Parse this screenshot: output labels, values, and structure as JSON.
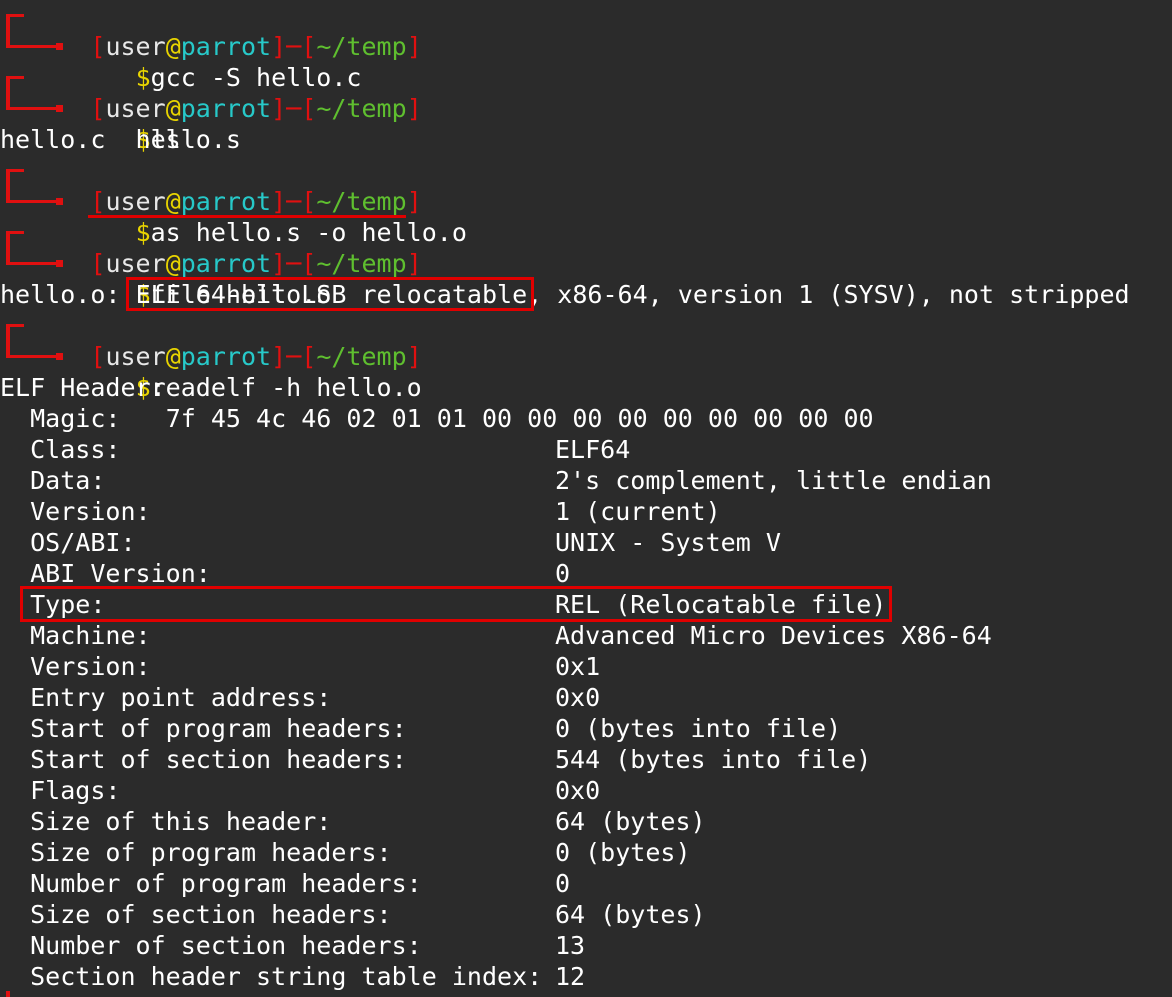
{
  "prompt": {
    "user": "user",
    "at": "@",
    "host": "parrot",
    "path": "~/temp",
    "dollar": "$"
  },
  "commands": [
    {
      "cmd": "gcc -S hello.c",
      "output": []
    },
    {
      "cmd": "ls",
      "output": [
        "hello.c  hello.s"
      ]
    },
    {
      "cmd": "as hello.s -o hello.o",
      "output": []
    },
    {
      "cmd": "file hello.o",
      "output": []
    },
    {
      "cmd": "readelf -h hello.o",
      "output": []
    }
  ],
  "file_output": {
    "prefix": "hello.o: ",
    "highlight": "ELF 64-bit LSB relocatable",
    "suffix": ", x86-64, version 1 (SYSV), not stripped"
  },
  "elf_header": {
    "title": "ELF Header:",
    "magic_label": "  Magic:   ",
    "magic_value": "7f 45 4c 46 02 01 01 00 00 00 00 00 00 00 00 00",
    "rows": [
      {
        "label": "  Class:",
        "value": "ELF64"
      },
      {
        "label": "  Data:",
        "value": "2's complement, little endian"
      },
      {
        "label": "  Version:",
        "value": "1 (current)"
      },
      {
        "label": "  OS/ABI:",
        "value": "UNIX - System V"
      },
      {
        "label": "  ABI Version:",
        "value": "0"
      },
      {
        "label": "  Type:",
        "value": "REL (Relocatable file)"
      },
      {
        "label": "  Machine:",
        "value": "Advanced Micro Devices X86-64"
      },
      {
        "label": "  Version:",
        "value": "0x1"
      },
      {
        "label": "  Entry point address:",
        "value": "0x0"
      },
      {
        "label": "  Start of program headers:",
        "value": "0 (bytes into file)"
      },
      {
        "label": "  Start of section headers:",
        "value": "544 (bytes into file)"
      },
      {
        "label": "  Flags:",
        "value": "0x0"
      },
      {
        "label": "  Size of this header:",
        "value": "64 (bytes)"
      },
      {
        "label": "  Size of program headers:",
        "value": "0 (bytes)"
      },
      {
        "label": "  Number of program headers:",
        "value": "0"
      },
      {
        "label": "  Size of section headers:",
        "value": "64 (bytes)"
      },
      {
        "label": "  Number of section headers:",
        "value": "13"
      },
      {
        "label": "  Section header string table index:",
        "value": "12"
      }
    ]
  },
  "colors": {
    "background": "#2b2b2b",
    "prompt_frame": "#e01010",
    "highlight": "#e00000",
    "host": "#27c9c9",
    "path": "#5fbf2f",
    "dollar": "#e8d400"
  }
}
